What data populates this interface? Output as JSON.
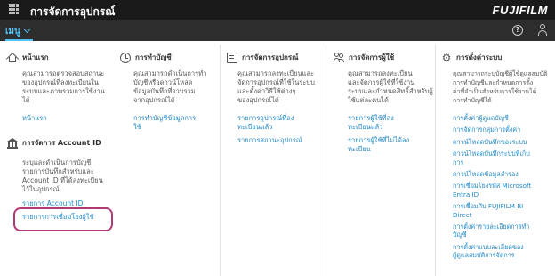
{
  "header": {
    "app_title": "การจัดการอุปกรณ์",
    "brand": "FUJIFILM",
    "menu_label": "เมนู",
    "help_symbol": "?"
  },
  "columns": {
    "home": {
      "title": "หน้าแรก",
      "icon": "home-icon",
      "description": [
        "คุณสามารถตรวจสอบสถานะ",
        "ของอุปกรณ์ที่ลงทะเบียนใน",
        "ระบบและภาพรวมการใช้งาน",
        "ได้"
      ],
      "links": [
        "หน้าแรก"
      ]
    },
    "account_id": {
      "title": "การจัดการ Account ID",
      "icon": "bank-icon",
      "description": [
        "ระบุและดำเนินการบัญชี",
        "รายการบันทึกสำหรับและ",
        "Account ID ที่ได้ลงทะเบียน",
        "ไว้ในอุปกรณ์"
      ],
      "links": [
        "รายการ Account ID",
        "รายการการเชื่อมโยงผู้ใช้"
      ]
    },
    "billing": {
      "title": "การทำบัญชี",
      "icon": "clock-icon",
      "description": [
        "คุณสามารถดำเนินการทำ",
        "บัญชีหรือดาวน์โหลด",
        "ข้อมูลบันทึกที่รวบรวม",
        "จากอุปกรณ์ได้"
      ],
      "links": [
        "การทำบัญชีข้อมูลการ",
        "ใช้"
      ]
    },
    "devices": {
      "title": "การจัดการอุปกรณ์",
      "icon": "device-icon",
      "description": [
        "คุณสามารถลงทะเบียนและ",
        "จัดการอุปกรณ์ที่ใช้ในระบบ",
        "และตั้งค่าวิธีใช้ต่างๆ",
        "ของอุปกรณ์ได้"
      ],
      "links": [
        "รายการอุปกรณ์ที่ลง",
        "ทะเบียนแล้ว",
        "รายการสถานะอุปกรณ์"
      ]
    },
    "users": {
      "title": "การจัดการผู้ใช้",
      "icon": "users-icon",
      "description": [
        "คุณสามารถลงทะเบียน",
        "และจัดการผู้ใช้ที่ใช้งาน",
        "ระบบและกำหนดสิทธิ์สำหรับผู้",
        "ใช้แต่ละคนได้"
      ],
      "links": [
        "รายการผู้ใช้ที่ลง",
        "ทะเบียนแล้ว",
        "รายการผู้ใช้ที่ไม่ได้ลง",
        "ทะเบียน"
      ]
    },
    "settings": {
      "title": "การตั้งค่าระบบ",
      "icon": "gear-icon",
      "description": [
        "คุณสามารถระบุบัญชีผู้ใช้ดูแลสมบัติ",
        "การทำบัญชีและกำหนดการตั้ง",
        "ค่าที่จำเป็นสำหรับการใช้งานได้",
        "การทำบัญชีได้"
      ],
      "links": [
        "การตั้งค่าผู้ดูแลบัญชี",
        "การจัดการกลุ่มการตั้งค่า",
        "ดาวน์โหลดบันทึกของระบบ",
        "ดาวน์โหลดบันทึกระบบที่เก็บ",
        "การ",
        "ดาวน์โหลดข้อมูลสำรอง",
        "การเชื่อมโยงรหัส Microsoft",
        "Entra ID",
        "การเชื่อมกับ FUJIFILM BI",
        "Direct",
        "การตั้งค่ารายละเอียดการทำ",
        "บัญชี",
        "การตั้งค่าแบบละเอียดของ",
        "ผู้ดูแลสมบัติการจัดการ"
      ]
    }
  }
}
